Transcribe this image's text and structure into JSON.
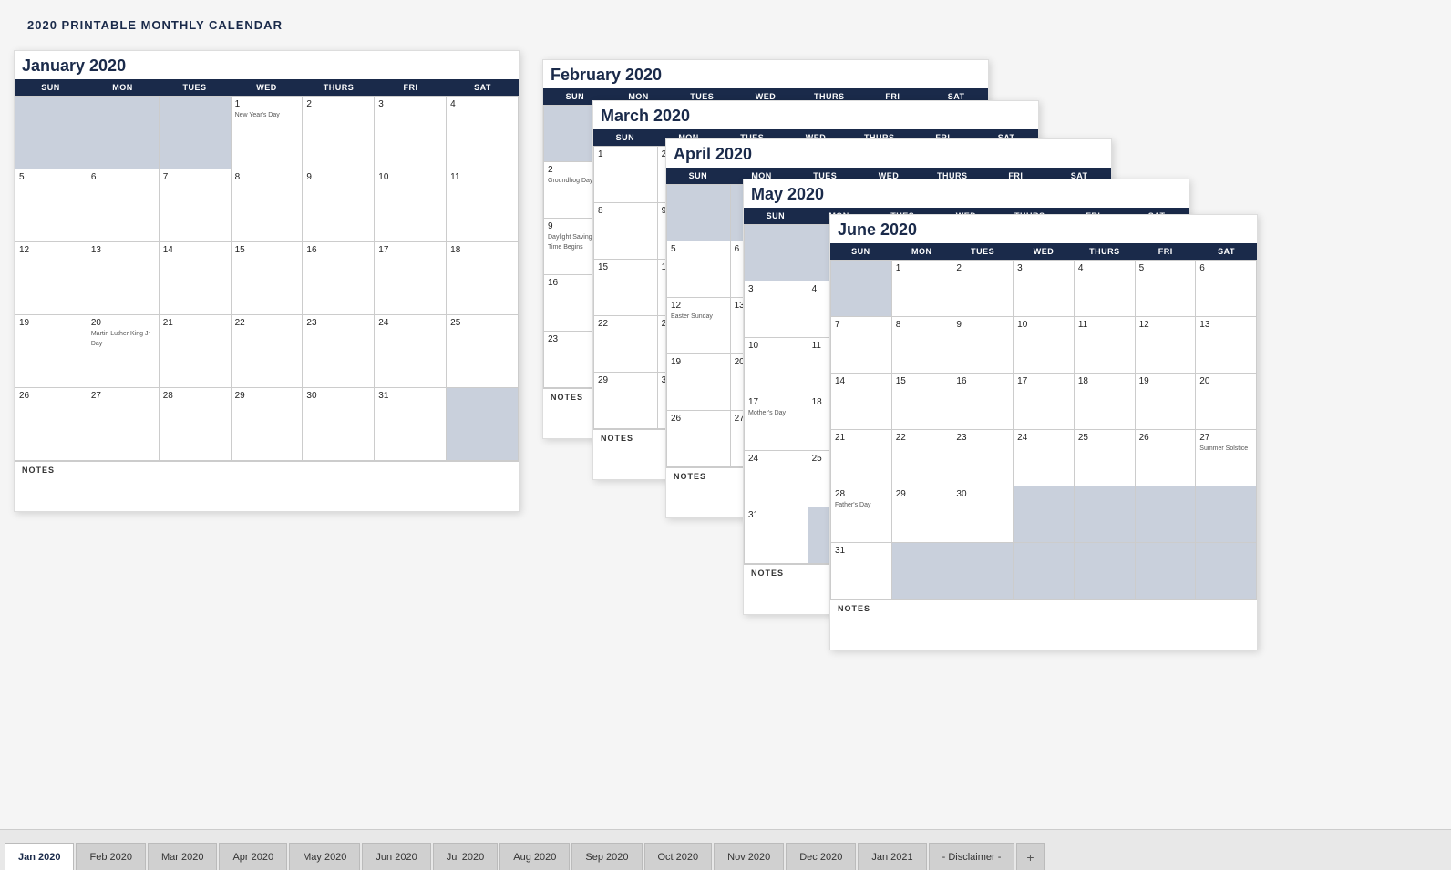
{
  "page": {
    "title": "2020 PRINTABLE MONTHLY CALENDAR"
  },
  "tabs": [
    {
      "label": "Jan 2020",
      "active": true
    },
    {
      "label": "Feb 2020",
      "active": false
    },
    {
      "label": "Mar 2020",
      "active": false
    },
    {
      "label": "Apr 2020",
      "active": false
    },
    {
      "label": "May 2020",
      "active": false
    },
    {
      "label": "Jun 2020",
      "active": false
    },
    {
      "label": "Jul 2020",
      "active": false
    },
    {
      "label": "Aug 2020",
      "active": false
    },
    {
      "label": "Sep 2020",
      "active": false
    },
    {
      "label": "Oct 2020",
      "active": false
    },
    {
      "label": "Nov 2020",
      "active": false
    },
    {
      "label": "Dec 2020",
      "active": false
    },
    {
      "label": "Jan 2021",
      "active": false
    },
    {
      "label": "- Disclaimer -",
      "active": false
    }
  ],
  "calendars": {
    "january": {
      "title": "January 2020",
      "headers": [
        "SUN",
        "MON",
        "TUES",
        "WED",
        "THURS",
        "FRI",
        "SAT"
      ]
    },
    "february": {
      "title": "February 2020",
      "headers": [
        "SUN",
        "MON",
        "TUES",
        "WED",
        "THURS",
        "FRI",
        "SAT"
      ]
    },
    "march": {
      "title": "March 2020",
      "headers": [
        "SUN",
        "MON",
        "TUES",
        "WED",
        "THURS",
        "FRI",
        "SAT"
      ]
    },
    "april": {
      "title": "April 2020",
      "headers": [
        "SUN",
        "MON",
        "TUES",
        "WED",
        "THURS",
        "FRI",
        "SAT"
      ]
    },
    "may": {
      "title": "May 2020",
      "headers": [
        "SUN",
        "MON",
        "TUES",
        "WED",
        "THURS",
        "FRI",
        "SAT"
      ]
    },
    "june": {
      "title": "June 2020",
      "headers": [
        "SUN",
        "MON",
        "TUES",
        "WED",
        "THURS",
        "FRI",
        "SAT"
      ]
    }
  }
}
